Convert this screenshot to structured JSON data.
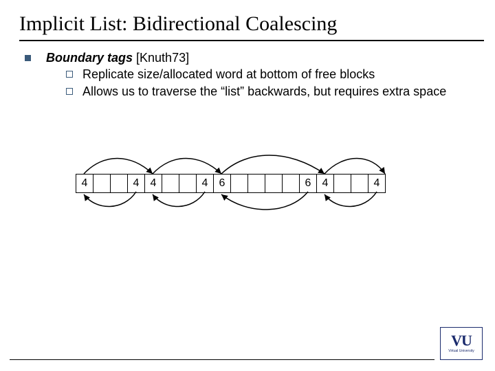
{
  "title": "Implicit List: Bidirectional Coalescing",
  "main_bullet": {
    "prefix": "Boundary tags",
    "suffix": " [Knuth73]"
  },
  "sub_bullets": [
    "Replicate size/allocated word at bottom of free blocks",
    "Allows us to traverse the “list” backwards, but requires extra space"
  ],
  "cells": [
    "4",
    "",
    "",
    "4",
    "4",
    "",
    "",
    "4",
    "6",
    "",
    "",
    "",
    "",
    "6",
    "4",
    "",
    "",
    "4"
  ],
  "logo": {
    "main": "VU",
    "sub": "Virtual University"
  }
}
